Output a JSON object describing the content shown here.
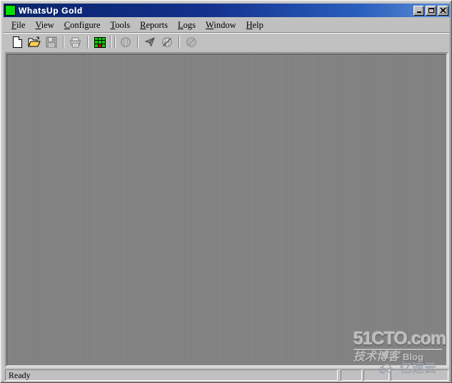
{
  "window": {
    "title": "WhatsUp Gold",
    "icon": "green-square-icon",
    "caption_buttons": [
      {
        "name": "minimize-button",
        "label": "_"
      },
      {
        "name": "maximize-button",
        "label": "□"
      },
      {
        "name": "close-button",
        "label": "✕"
      }
    ]
  },
  "menu": {
    "items": [
      {
        "label": "File",
        "accel": "F"
      },
      {
        "label": "View",
        "accel": "V"
      },
      {
        "label": "Configure",
        "accel": "C"
      },
      {
        "label": "Tools",
        "accel": "T"
      },
      {
        "label": "Reports",
        "accel": "R"
      },
      {
        "label": "Logs",
        "accel": "L"
      },
      {
        "label": "Window",
        "accel": "W"
      },
      {
        "label": "Help",
        "accel": "H"
      }
    ]
  },
  "toolbar": {
    "buttons": [
      {
        "name": "new-map-button",
        "icon": "new-document-icon",
        "enabled": true,
        "tooltip": "New"
      },
      {
        "name": "open-map-button",
        "icon": "open-folder-icon",
        "enabled": true,
        "tooltip": "Open"
      },
      {
        "name": "save-map-button",
        "icon": "save-floppy-icon",
        "enabled": false,
        "tooltip": "Save"
      },
      {
        "name": "print-button",
        "icon": "printer-icon",
        "enabled": false,
        "tooltip": "Print"
      },
      {
        "name": "map-view-button",
        "icon": "green-grid-icon",
        "enabled": true,
        "tooltip": "Map View"
      },
      {
        "name": "discover-button",
        "icon": "globe-icon",
        "enabled": false,
        "tooltip": "Discover"
      },
      {
        "name": "select-tool-button",
        "icon": "arrow-cursor-icon",
        "enabled": true,
        "tooltip": "Select"
      },
      {
        "name": "web-browse-button",
        "icon": "globe-slash-icon",
        "enabled": false,
        "tooltip": "Browse"
      },
      {
        "name": "stop-polling-button",
        "icon": "no-entry-icon",
        "enabled": false,
        "tooltip": "Stop Polling"
      }
    ]
  },
  "status": {
    "text": "Ready",
    "panes": [
      "",
      "",
      ""
    ]
  },
  "watermarks": {
    "primary": "51CTO.com",
    "primary_sub": "技术博客",
    "primary_sub_en": "Blog",
    "secondary": "亿速云"
  },
  "colors": {
    "title_bar_start": "#0a246a",
    "title_bar_end": "#5c8fd6",
    "face": "#c0c0c0",
    "client_area": "#828282",
    "app_icon": "#00e000",
    "grid_green": "#00d000",
    "grid_red": "#d00000"
  }
}
